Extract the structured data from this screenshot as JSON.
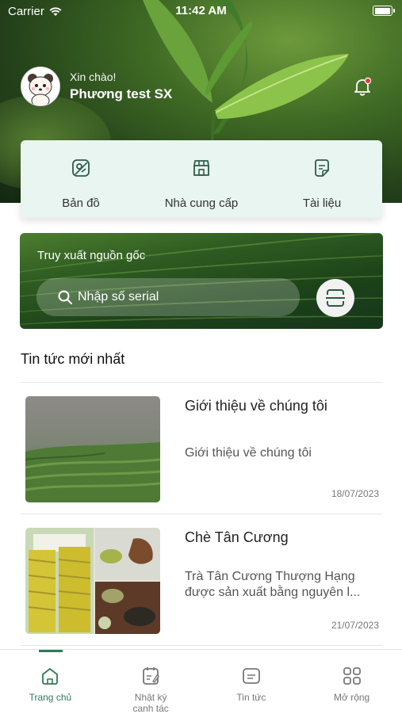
{
  "status_bar": {
    "carrier": "Carrier",
    "time": "11:42 AM"
  },
  "header": {
    "greeting": "Xin chào!",
    "user_name": "Phương test SX"
  },
  "quick_actions": [
    {
      "label": "Bản đồ",
      "icon": "map-icon"
    },
    {
      "label": "Nhà cung cấp",
      "icon": "store-icon"
    },
    {
      "label": "Tài liệu",
      "icon": "document-icon"
    }
  ],
  "traceability": {
    "title": "Truy xuất nguồn gốc",
    "search_placeholder": "Nhập số serial",
    "scan_icon": "scan-icon"
  },
  "news_section": {
    "title": "Tin tức mới nhất",
    "items": [
      {
        "title": "Giới thiệu về chúng tôi",
        "description": "Giới thiệu về chúng tôi",
        "date": "18/07/2023"
      },
      {
        "title": "Chè Tân Cương",
        "description": "Trà Tân Cương Thượng Hạng được sản xuất bằng nguyên l...",
        "date": "21/07/2023"
      }
    ]
  },
  "tab_bar": {
    "tabs": [
      {
        "label": "Trang chủ",
        "icon": "home-icon",
        "active": true
      },
      {
        "label": "Nhật ký canh tác",
        "icon": "journal-icon",
        "active": false
      },
      {
        "label": "Tin tức",
        "icon": "news-icon",
        "active": false
      },
      {
        "label": "Mở rộng",
        "icon": "grid-icon",
        "active": false
      }
    ]
  },
  "colors": {
    "accent": "#2e7a58",
    "quick_panel_bg": "#e8f5f0",
    "notification_dot": "#e53935"
  }
}
